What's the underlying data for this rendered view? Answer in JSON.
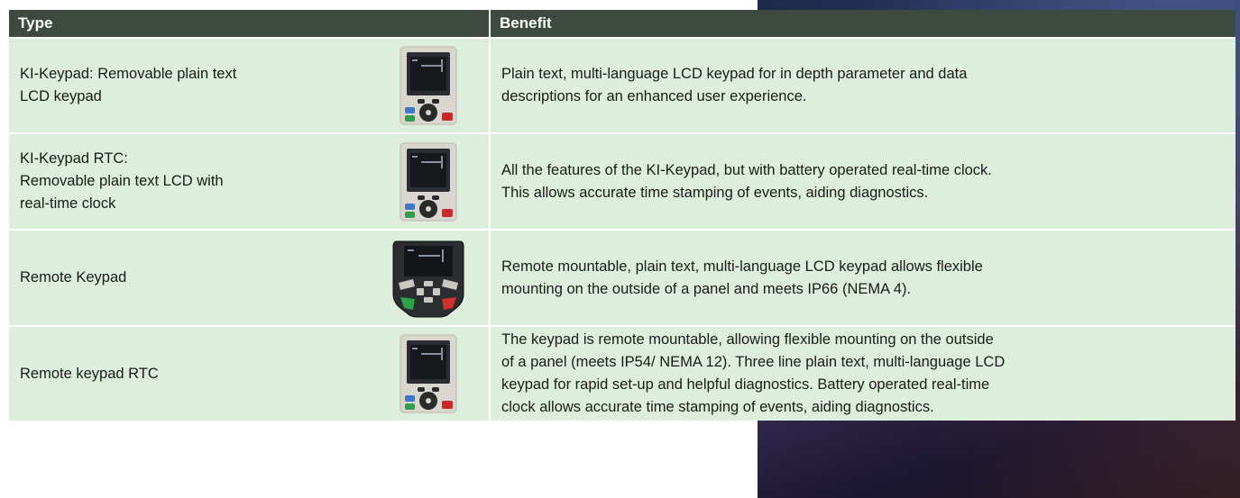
{
  "table": {
    "headers": {
      "type": "Type",
      "benefit": "Benefit"
    },
    "rows": [
      {
        "type_lines": [
          "KI-Keypad: Removable plain text",
          "LCD keypad"
        ],
        "image_icon": "keypad-icon",
        "benefit_lines": [
          "Plain text, multi-language LCD keypad for in depth parameter and data",
          "descriptions for an enhanced user experience."
        ]
      },
      {
        "type_lines": [
          "KI-Keypad RTC:",
          "Removable plain text LCD with",
          "real-time clock"
        ],
        "image_icon": "keypad-icon",
        "benefit_lines": [
          "All the features of the KI-Keypad, but with battery operated real-time clock.",
          "This allows accurate time stamping of events, aiding diagnostics."
        ]
      },
      {
        "type_lines": [
          "Remote Keypad"
        ],
        "image_icon": "remote-keypad-icon",
        "benefit_lines": [
          "Remote mountable, plain text, multi-language LCD keypad allows flexible",
          "mounting on the outside of a panel and meets IP66 (NEMA 4)."
        ]
      },
      {
        "type_lines": [
          "Remote keypad RTC"
        ],
        "image_icon": "keypad-icon",
        "benefit_lines": [
          "The keypad is remote mountable, allowing flexible mounting on the outside",
          "of a panel (meets IP54/ NEMA 12). Three line plain text, multi-language LCD",
          "keypad for rapid set-up and helpful diagnostics. Battery operated real-time",
          "clock allows accurate time stamping of events, aiding diagnostics."
        ]
      }
    ]
  },
  "colors": {
    "header_bg": "#3e4a40",
    "row_bg": "#ddefdc",
    "divider": "#ffffff"
  }
}
